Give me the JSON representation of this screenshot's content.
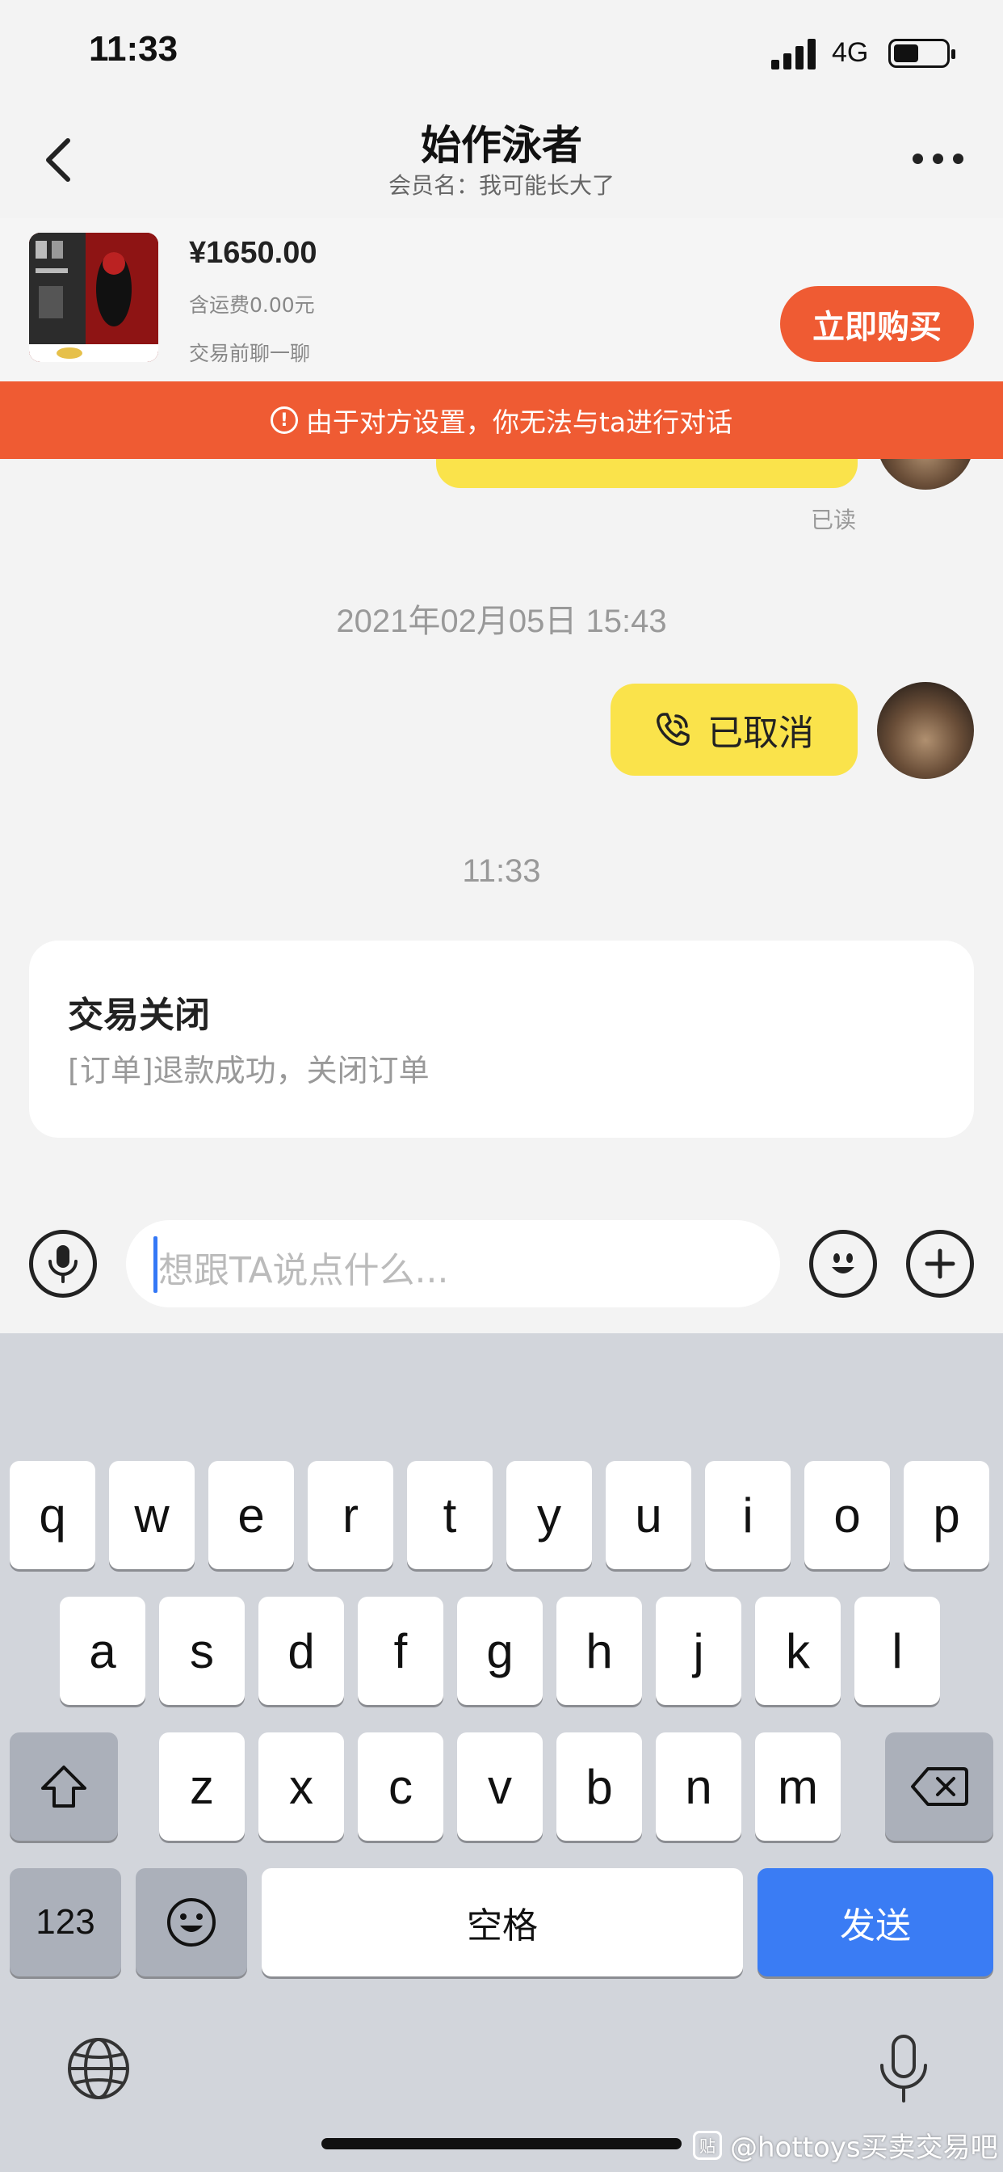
{
  "status_bar": {
    "time": "11:33",
    "network": "4G"
  },
  "header": {
    "title": "始作泳者",
    "subtitle": "会员名：我可能长大了"
  },
  "product": {
    "price": "¥1650.00",
    "shipping": "含运费0.00元",
    "note": "交易前聊一聊",
    "buy_label": "立即购买"
  },
  "banner": {
    "text": "由于对方设置，你无法与ta进行对话"
  },
  "chat": {
    "read_status": "已读",
    "timestamp_1": "2021年02月05日 15:43",
    "call_text": "已取消",
    "timestamp_2": "11:33",
    "order_card": {
      "title": "交易关闭",
      "description": "[订单]退款成功，关闭订单"
    }
  },
  "input_bar": {
    "placeholder": "想跟TA说点什么..."
  },
  "keyboard": {
    "row1": [
      "q",
      "w",
      "e",
      "r",
      "t",
      "y",
      "u",
      "i",
      "o",
      "p"
    ],
    "row2": [
      "a",
      "s",
      "d",
      "f",
      "g",
      "h",
      "j",
      "k",
      "l"
    ],
    "row3": [
      "z",
      "x",
      "c",
      "v",
      "b",
      "n",
      "m"
    ],
    "numbers_label": "123",
    "space_label": "空格",
    "send_label": "发送"
  },
  "watermark": {
    "text": "@hottoys买卖交易吧"
  },
  "colors": {
    "accent": "#ef5b33",
    "bubble": "#fae34b",
    "send": "#3a7cf4"
  }
}
